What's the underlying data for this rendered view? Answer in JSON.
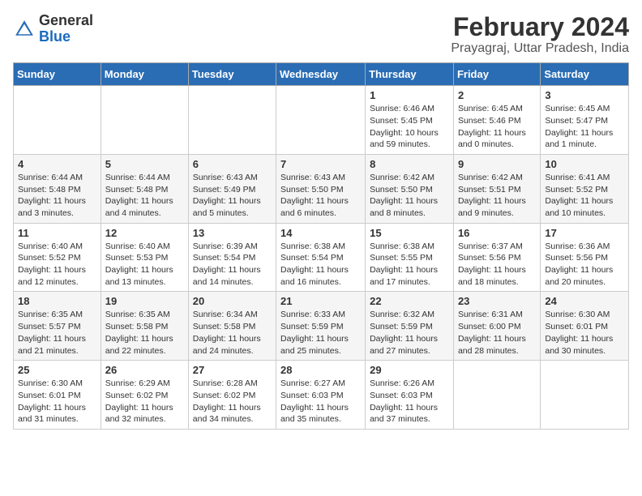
{
  "logo": {
    "general": "General",
    "blue": "Blue"
  },
  "title": "February 2024",
  "location": "Prayagraj, Uttar Pradesh, India",
  "days_of_week": [
    "Sunday",
    "Monday",
    "Tuesday",
    "Wednesday",
    "Thursday",
    "Friday",
    "Saturday"
  ],
  "weeks": [
    [
      {
        "day": "",
        "info": ""
      },
      {
        "day": "",
        "info": ""
      },
      {
        "day": "",
        "info": ""
      },
      {
        "day": "",
        "info": ""
      },
      {
        "day": "1",
        "info": "Sunrise: 6:46 AM\nSunset: 5:45 PM\nDaylight: 10 hours and 59 minutes."
      },
      {
        "day": "2",
        "info": "Sunrise: 6:45 AM\nSunset: 5:46 PM\nDaylight: 11 hours and 0 minutes."
      },
      {
        "day": "3",
        "info": "Sunrise: 6:45 AM\nSunset: 5:47 PM\nDaylight: 11 hours and 1 minute."
      }
    ],
    [
      {
        "day": "4",
        "info": "Sunrise: 6:44 AM\nSunset: 5:48 PM\nDaylight: 11 hours and 3 minutes."
      },
      {
        "day": "5",
        "info": "Sunrise: 6:44 AM\nSunset: 5:48 PM\nDaylight: 11 hours and 4 minutes."
      },
      {
        "day": "6",
        "info": "Sunrise: 6:43 AM\nSunset: 5:49 PM\nDaylight: 11 hours and 5 minutes."
      },
      {
        "day": "7",
        "info": "Sunrise: 6:43 AM\nSunset: 5:50 PM\nDaylight: 11 hours and 6 minutes."
      },
      {
        "day": "8",
        "info": "Sunrise: 6:42 AM\nSunset: 5:50 PM\nDaylight: 11 hours and 8 minutes."
      },
      {
        "day": "9",
        "info": "Sunrise: 6:42 AM\nSunset: 5:51 PM\nDaylight: 11 hours and 9 minutes."
      },
      {
        "day": "10",
        "info": "Sunrise: 6:41 AM\nSunset: 5:52 PM\nDaylight: 11 hours and 10 minutes."
      }
    ],
    [
      {
        "day": "11",
        "info": "Sunrise: 6:40 AM\nSunset: 5:52 PM\nDaylight: 11 hours and 12 minutes."
      },
      {
        "day": "12",
        "info": "Sunrise: 6:40 AM\nSunset: 5:53 PM\nDaylight: 11 hours and 13 minutes."
      },
      {
        "day": "13",
        "info": "Sunrise: 6:39 AM\nSunset: 5:54 PM\nDaylight: 11 hours and 14 minutes."
      },
      {
        "day": "14",
        "info": "Sunrise: 6:38 AM\nSunset: 5:54 PM\nDaylight: 11 hours and 16 minutes."
      },
      {
        "day": "15",
        "info": "Sunrise: 6:38 AM\nSunset: 5:55 PM\nDaylight: 11 hours and 17 minutes."
      },
      {
        "day": "16",
        "info": "Sunrise: 6:37 AM\nSunset: 5:56 PM\nDaylight: 11 hours and 18 minutes."
      },
      {
        "day": "17",
        "info": "Sunrise: 6:36 AM\nSunset: 5:56 PM\nDaylight: 11 hours and 20 minutes."
      }
    ],
    [
      {
        "day": "18",
        "info": "Sunrise: 6:35 AM\nSunset: 5:57 PM\nDaylight: 11 hours and 21 minutes."
      },
      {
        "day": "19",
        "info": "Sunrise: 6:35 AM\nSunset: 5:58 PM\nDaylight: 11 hours and 22 minutes."
      },
      {
        "day": "20",
        "info": "Sunrise: 6:34 AM\nSunset: 5:58 PM\nDaylight: 11 hours and 24 minutes."
      },
      {
        "day": "21",
        "info": "Sunrise: 6:33 AM\nSunset: 5:59 PM\nDaylight: 11 hours and 25 minutes."
      },
      {
        "day": "22",
        "info": "Sunrise: 6:32 AM\nSunset: 5:59 PM\nDaylight: 11 hours and 27 minutes."
      },
      {
        "day": "23",
        "info": "Sunrise: 6:31 AM\nSunset: 6:00 PM\nDaylight: 11 hours and 28 minutes."
      },
      {
        "day": "24",
        "info": "Sunrise: 6:30 AM\nSunset: 6:01 PM\nDaylight: 11 hours and 30 minutes."
      }
    ],
    [
      {
        "day": "25",
        "info": "Sunrise: 6:30 AM\nSunset: 6:01 PM\nDaylight: 11 hours and 31 minutes."
      },
      {
        "day": "26",
        "info": "Sunrise: 6:29 AM\nSunset: 6:02 PM\nDaylight: 11 hours and 32 minutes."
      },
      {
        "day": "27",
        "info": "Sunrise: 6:28 AM\nSunset: 6:02 PM\nDaylight: 11 hours and 34 minutes."
      },
      {
        "day": "28",
        "info": "Sunrise: 6:27 AM\nSunset: 6:03 PM\nDaylight: 11 hours and 35 minutes."
      },
      {
        "day": "29",
        "info": "Sunrise: 6:26 AM\nSunset: 6:03 PM\nDaylight: 11 hours and 37 minutes."
      },
      {
        "day": "",
        "info": ""
      },
      {
        "day": "",
        "info": ""
      }
    ]
  ]
}
